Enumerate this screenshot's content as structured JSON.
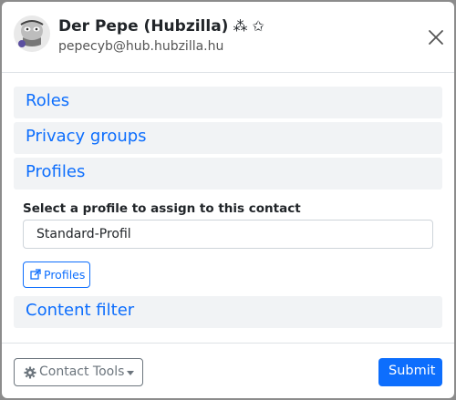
{
  "contact": {
    "name": "Der Pepe (Hubzilla)",
    "badges": "⁂ ✩",
    "address": "pepecyb@hub.hubzilla.hu",
    "avatar_icon": "avatar-image"
  },
  "sections": {
    "roles": "Roles",
    "privacy_groups": "Privacy groups",
    "profiles": "Profiles",
    "content_filter": "Content filter"
  },
  "profile_assign": {
    "label": "Select a profile to assign to this contact",
    "selected": "Standard-Profil",
    "profiles_button": "Profiles"
  },
  "footer": {
    "tools_label": "Contact Tools",
    "submit_label": "Submit"
  },
  "colors": {
    "accent": "#0d6efd",
    "section_bg": "#f1f3f5",
    "secondary": "#6c757d"
  },
  "icons": {
    "close": "close-icon",
    "external_link": "external-link-icon",
    "gear": "gear-icon",
    "caret": "caret-down-icon"
  }
}
